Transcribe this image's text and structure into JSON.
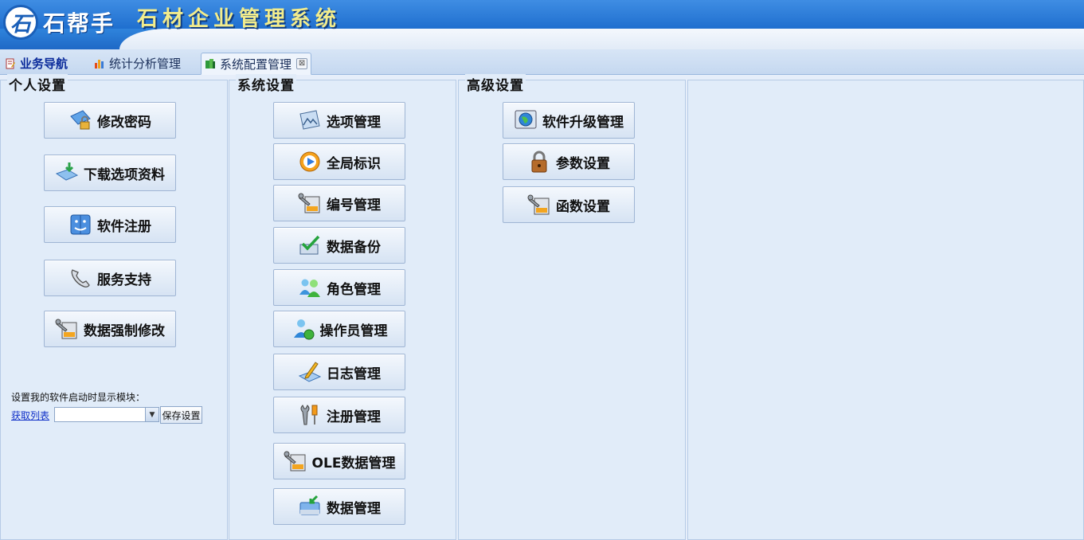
{
  "header": {
    "logo_glyph": "石",
    "brand": "石帮手",
    "system_title": "石材企业管理系统"
  },
  "tabs": [
    {
      "label": "业务导航",
      "icon": "notebook-icon"
    },
    {
      "label": "统计分析管理",
      "icon": "bar-chart-icon"
    },
    {
      "label": "系统配置管理",
      "icon": "books-icon",
      "active": true,
      "close": "⊠"
    }
  ],
  "panels": {
    "personal": {
      "title": "个人设置",
      "buttons": [
        {
          "label": "修改密码",
          "icon": "password-lock-icon"
        },
        {
          "label": "下载选项资料",
          "icon": "download-tray-icon"
        },
        {
          "label": "软件注册",
          "icon": "finder-face-icon"
        },
        {
          "label": "服务支持",
          "icon": "telephone-icon"
        },
        {
          "label": "数据强制修改",
          "icon": "wrench-disk-icon"
        }
      ],
      "startup": {
        "label": "设置我的软件启动时显示模块：",
        "get_list": "获取列表",
        "selected": "",
        "save": "保存设置"
      }
    },
    "system": {
      "title": "系统设置",
      "buttons": [
        {
          "label": "选项管理",
          "icon": "picture-frame-icon"
        },
        {
          "label": "全局标识",
          "icon": "play-circle-icon"
        },
        {
          "label": "编号管理",
          "icon": "wrench-disk-icon"
        },
        {
          "label": "数据备份",
          "icon": "backup-check-icon"
        },
        {
          "label": "角色管理",
          "icon": "users-group-icon"
        },
        {
          "label": "操作员管理",
          "icon": "user-globe-icon"
        },
        {
          "label": "日志管理",
          "icon": "pencil-note-icon"
        },
        {
          "label": "注册管理",
          "icon": "tools-icon"
        },
        {
          "label": "OLE数据管理",
          "icon": "wrench-disk-icon"
        },
        {
          "label": "数据管理",
          "icon": "drive-arrow-icon"
        }
      ]
    },
    "advanced": {
      "title": "高级设置",
      "buttons": [
        {
          "label": "软件升级管理",
          "icon": "globe-screen-icon"
        },
        {
          "label": "参数设置",
          "icon": "padlock-icon"
        },
        {
          "label": "函数设置",
          "icon": "wrench-disk-icon"
        }
      ]
    }
  }
}
